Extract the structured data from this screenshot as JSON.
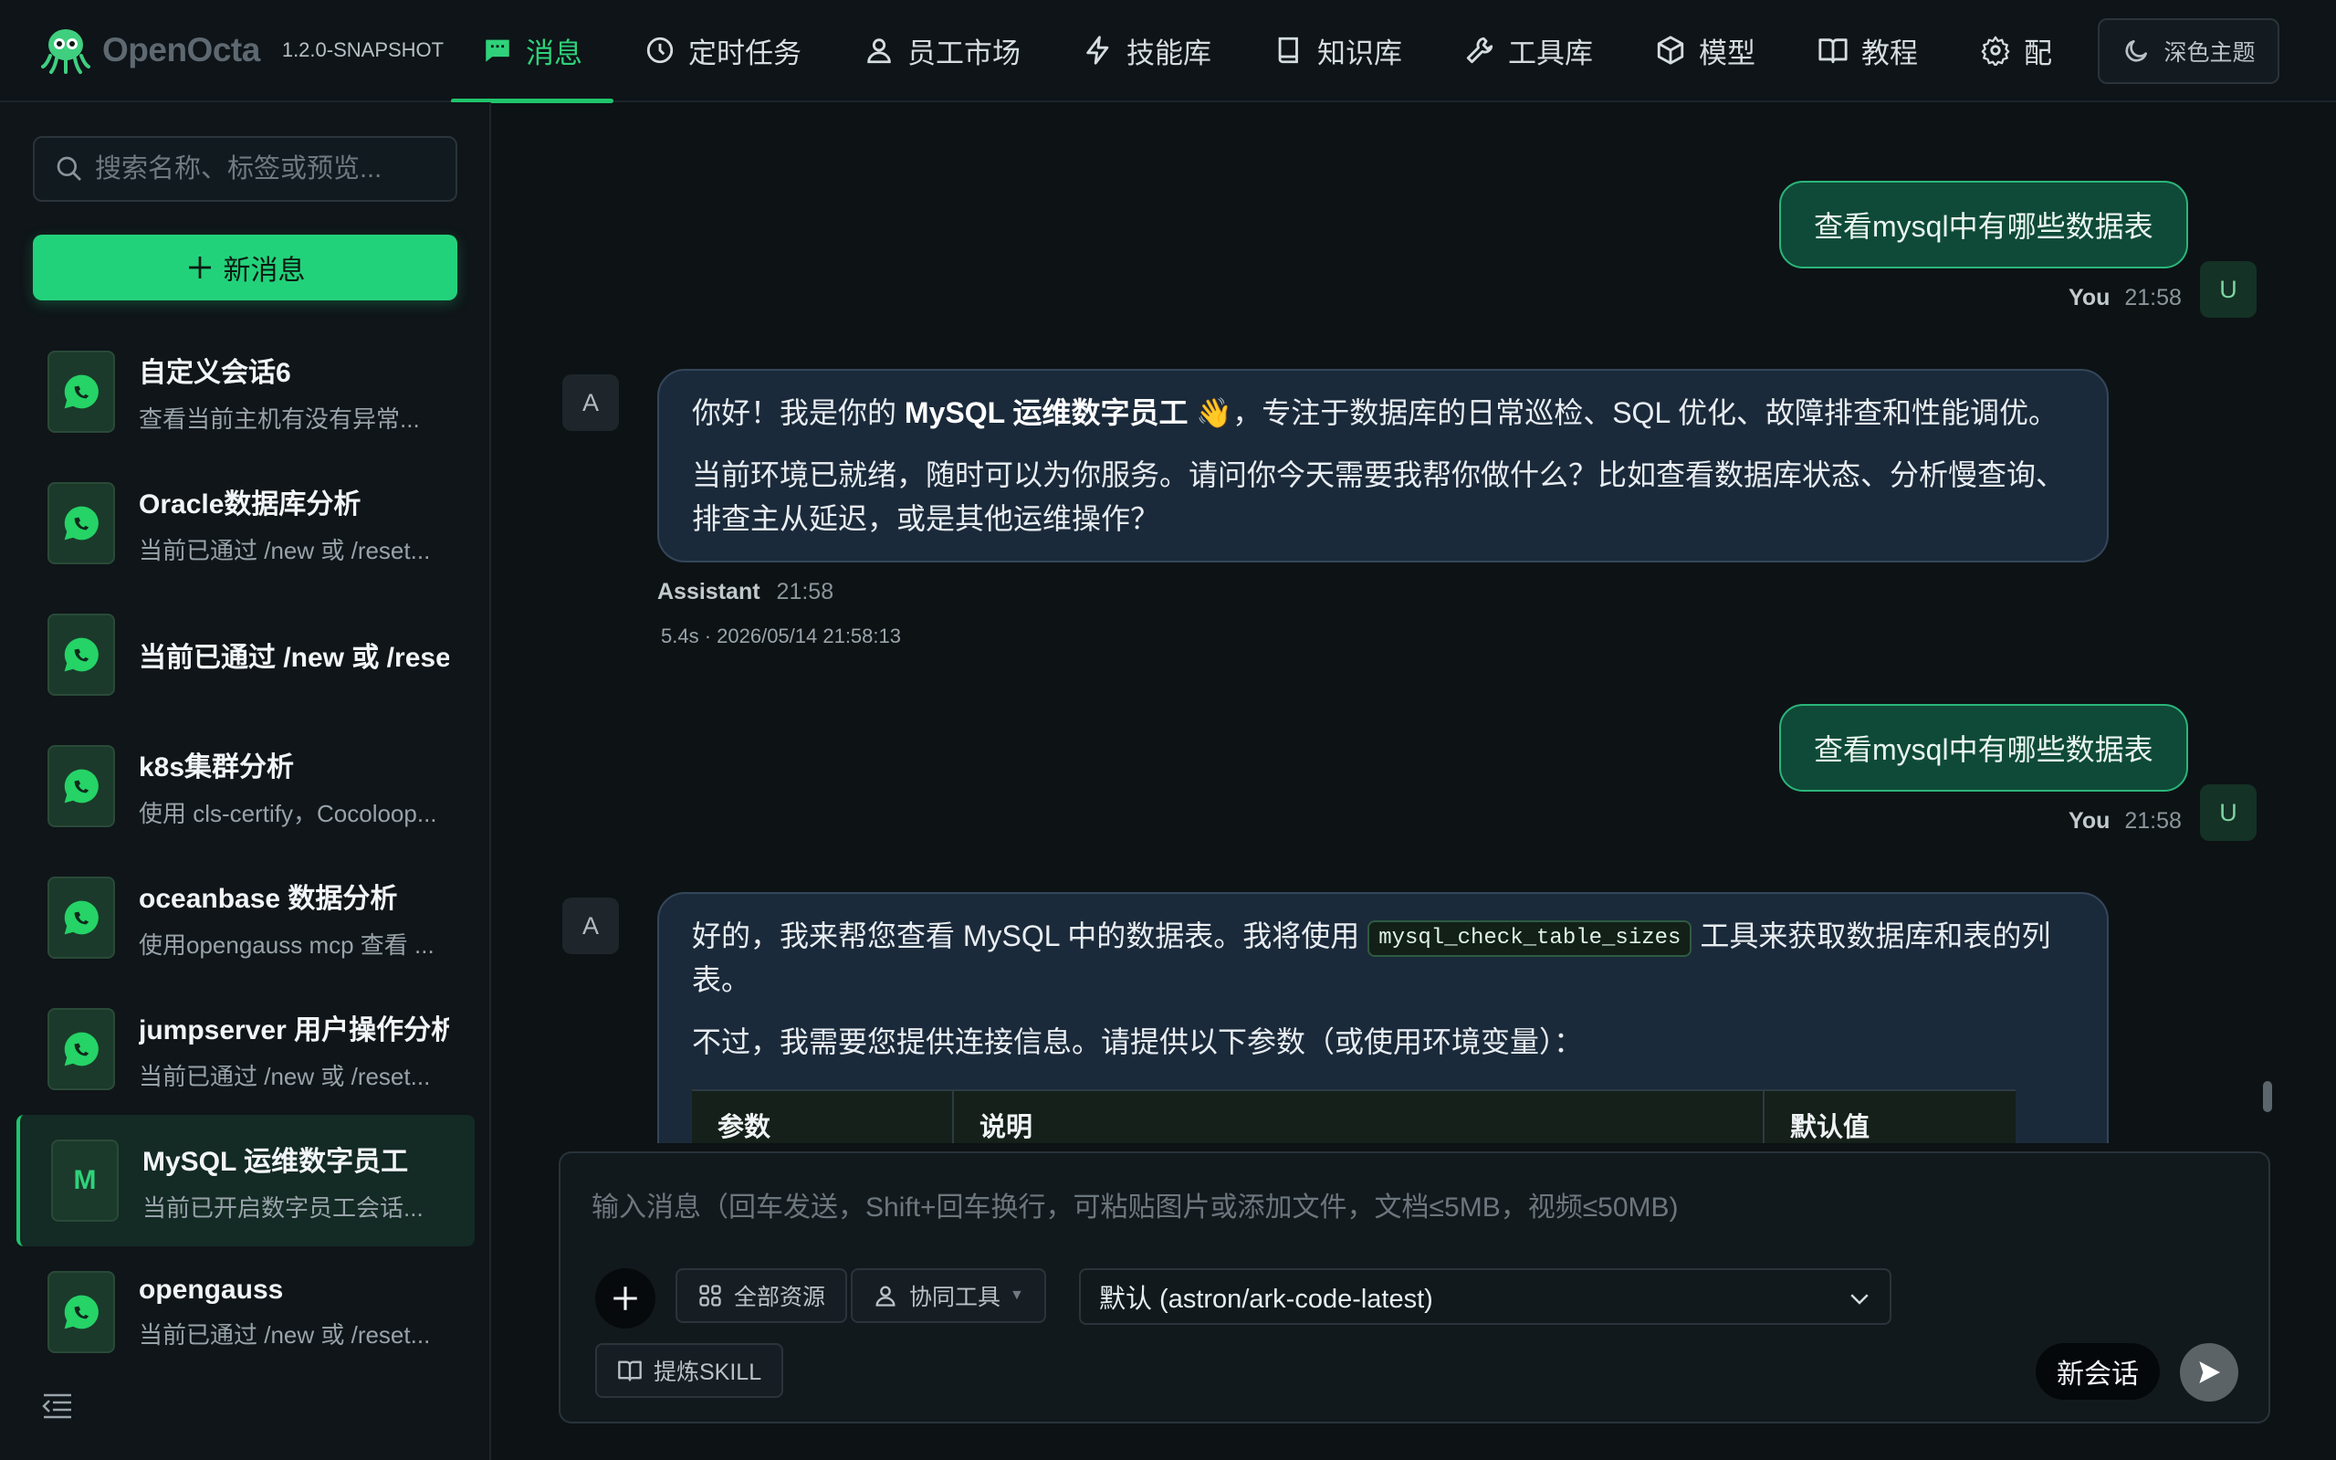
{
  "brand": {
    "name": "OpenOcta",
    "version": "1.2.0-SNAPSHOT"
  },
  "nav": {
    "items": [
      {
        "label": "消息",
        "icon": "chat-icon",
        "active": true
      },
      {
        "label": "定时任务",
        "icon": "clock-icon"
      },
      {
        "label": "员工市场",
        "icon": "user-icon"
      },
      {
        "label": "技能库",
        "icon": "lightning-icon"
      },
      {
        "label": "知识库",
        "icon": "book-icon"
      },
      {
        "label": "工具库",
        "icon": "wrench-icon"
      },
      {
        "label": "模型",
        "icon": "cube-icon"
      },
      {
        "label": "教程",
        "icon": "open-book-icon"
      },
      {
        "label": "配",
        "icon": "gear-icon"
      }
    ],
    "theme_label": "深色主题"
  },
  "sidebar": {
    "search_placeholder": "搜索名称、标签或预览...",
    "new_label": "新消息",
    "conversations": [
      {
        "title": "自定义会话6",
        "preview": "查看当前主机有没有异常...",
        "icon": "whatsapp-icon"
      },
      {
        "title": "Oracle数据库分析",
        "preview": "当前已通过 /new 或 /reset...",
        "icon": "whatsapp-icon"
      },
      {
        "title": "当前已通过 /new 或 /reset",
        "preview": "",
        "icon": "whatsapp-icon"
      },
      {
        "title": "k8s集群分析",
        "preview": "使用 cls-certify，Cocoloop...",
        "icon": "whatsapp-icon"
      },
      {
        "title": "oceanbase 数据分析",
        "preview": "使用opengauss mcp 查看 ...",
        "icon": "whatsapp-icon"
      },
      {
        "title": "jumpserver 用户操作分析",
        "preview": "当前已通过 /new 或 /reset...",
        "icon": "whatsapp-icon"
      },
      {
        "title": "MySQL 运维数字员工",
        "preview": "当前已开启数字员工会话...",
        "avatar_letter": "M",
        "active": true
      },
      {
        "title": "opengauss",
        "preview": "当前已通过 /new 或 /reset...",
        "icon": "whatsapp-icon"
      }
    ]
  },
  "chat": {
    "messages": [
      {
        "role": "user",
        "text": "查看mysql中有哪些数据表",
        "author": "You",
        "time": "21:58",
        "avatar": "U"
      },
      {
        "role": "assistant",
        "avatar": "A",
        "p1_pre": "你好！我是你的 ",
        "p1_bold": "MySQL 运维数字员工",
        "p1_emoji": "👋",
        "p1_post": "，专注于数据库的日常巡检、SQL 优化、故障排查和性能调优。",
        "p2": "当前环境已就绪，随时可以为你服务。请问你今天需要我帮你做什么？比如查看数据库状态、分析慢查询、排查主从延迟，或是其他运维操作？",
        "author": "Assistant",
        "time": "21:58",
        "stats": "5.4s · 2026/05/14 21:58:13"
      },
      {
        "role": "user",
        "text": "查看mysql中有哪些数据表",
        "author": "You",
        "time": "21:58",
        "avatar": "U"
      },
      {
        "role": "assistant",
        "avatar": "A",
        "p1_pre": "好的，我来帮您查看 MySQL 中的数据表。我将使用 ",
        "p1_code": "mysql_check_table_sizes",
        "p1_post": " 工具来获取数据库和表的列表。",
        "p2": "不过，我需要您提供连接信息。请提供以下参数（或使用环境变量）：",
        "table_headers": [
          "参数",
          "说明",
          "默认值"
        ]
      }
    ]
  },
  "composer": {
    "placeholder": "输入消息（回车发送，Shift+回车换行，可粘贴图片或添加文件，文档≤5MB，视频≤50MB)",
    "resources_label": "全部资源",
    "tools_label": "协同工具",
    "model_value": "默认 (astron/ark-code-latest)",
    "skill_label": "提炼SKILL",
    "new_session_label": "新会话"
  },
  "colors": {
    "accent": "#22d27a",
    "user_bubble": "#0f4a38",
    "ai_bubble": "#1b2a3a",
    "background": "#0d1215"
  }
}
